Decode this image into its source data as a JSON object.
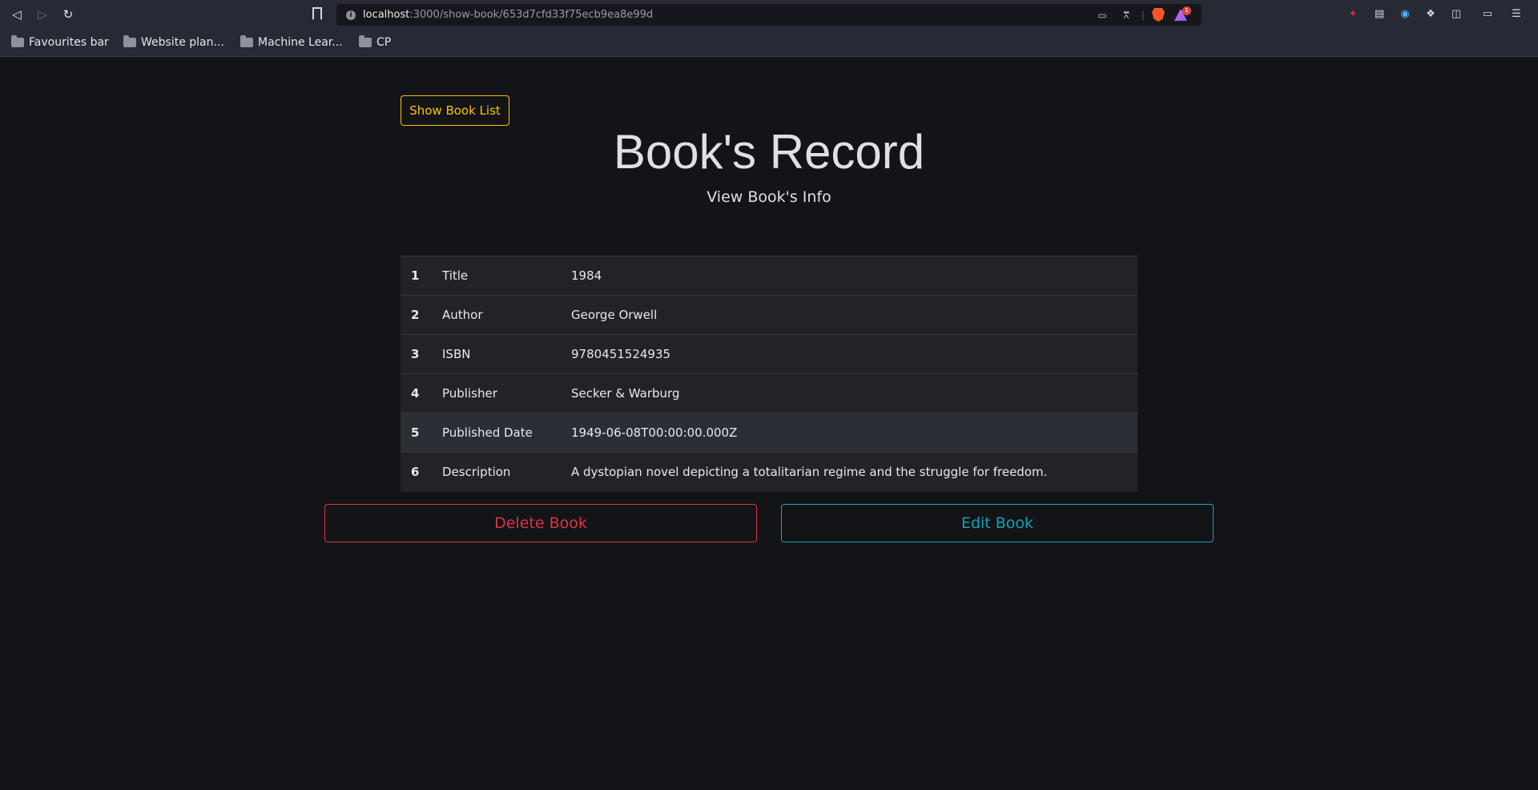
{
  "browser": {
    "url_host": "localhost",
    "url_path": ":3000/show-book/653d7cfd33f75ecb9ea8e99d",
    "rewards_badge": "1",
    "bookmarks": [
      {
        "label": "Favourites bar"
      },
      {
        "label": "Website plan..."
      },
      {
        "label": "Machine Lear..."
      },
      {
        "label": "CP"
      }
    ]
  },
  "page": {
    "show_list_label": "Show Book List",
    "title": "Book's Record",
    "subtitle": "View Book's Info"
  },
  "book_table": {
    "rows": [
      {
        "num": "1",
        "label": "Title",
        "value": "1984"
      },
      {
        "num": "2",
        "label": "Author",
        "value": "George Orwell"
      },
      {
        "num": "3",
        "label": "ISBN",
        "value": "9780451524935"
      },
      {
        "num": "4",
        "label": "Publisher",
        "value": "Secker & Warburg"
      },
      {
        "num": "5",
        "label": "Published Date",
        "value": "1949-06-08T00:00:00.000Z"
      },
      {
        "num": "6",
        "label": "Description",
        "value": "A dystopian novel depicting a totalitarian regime and the struggle for freedom."
      }
    ]
  },
  "actions": {
    "delete_label": "Delete Book",
    "edit_label": "Edit Book"
  },
  "colors": {
    "background": "#131417",
    "warning": "#ffc107",
    "danger": "#dc3545",
    "info": "#17a2b8"
  }
}
